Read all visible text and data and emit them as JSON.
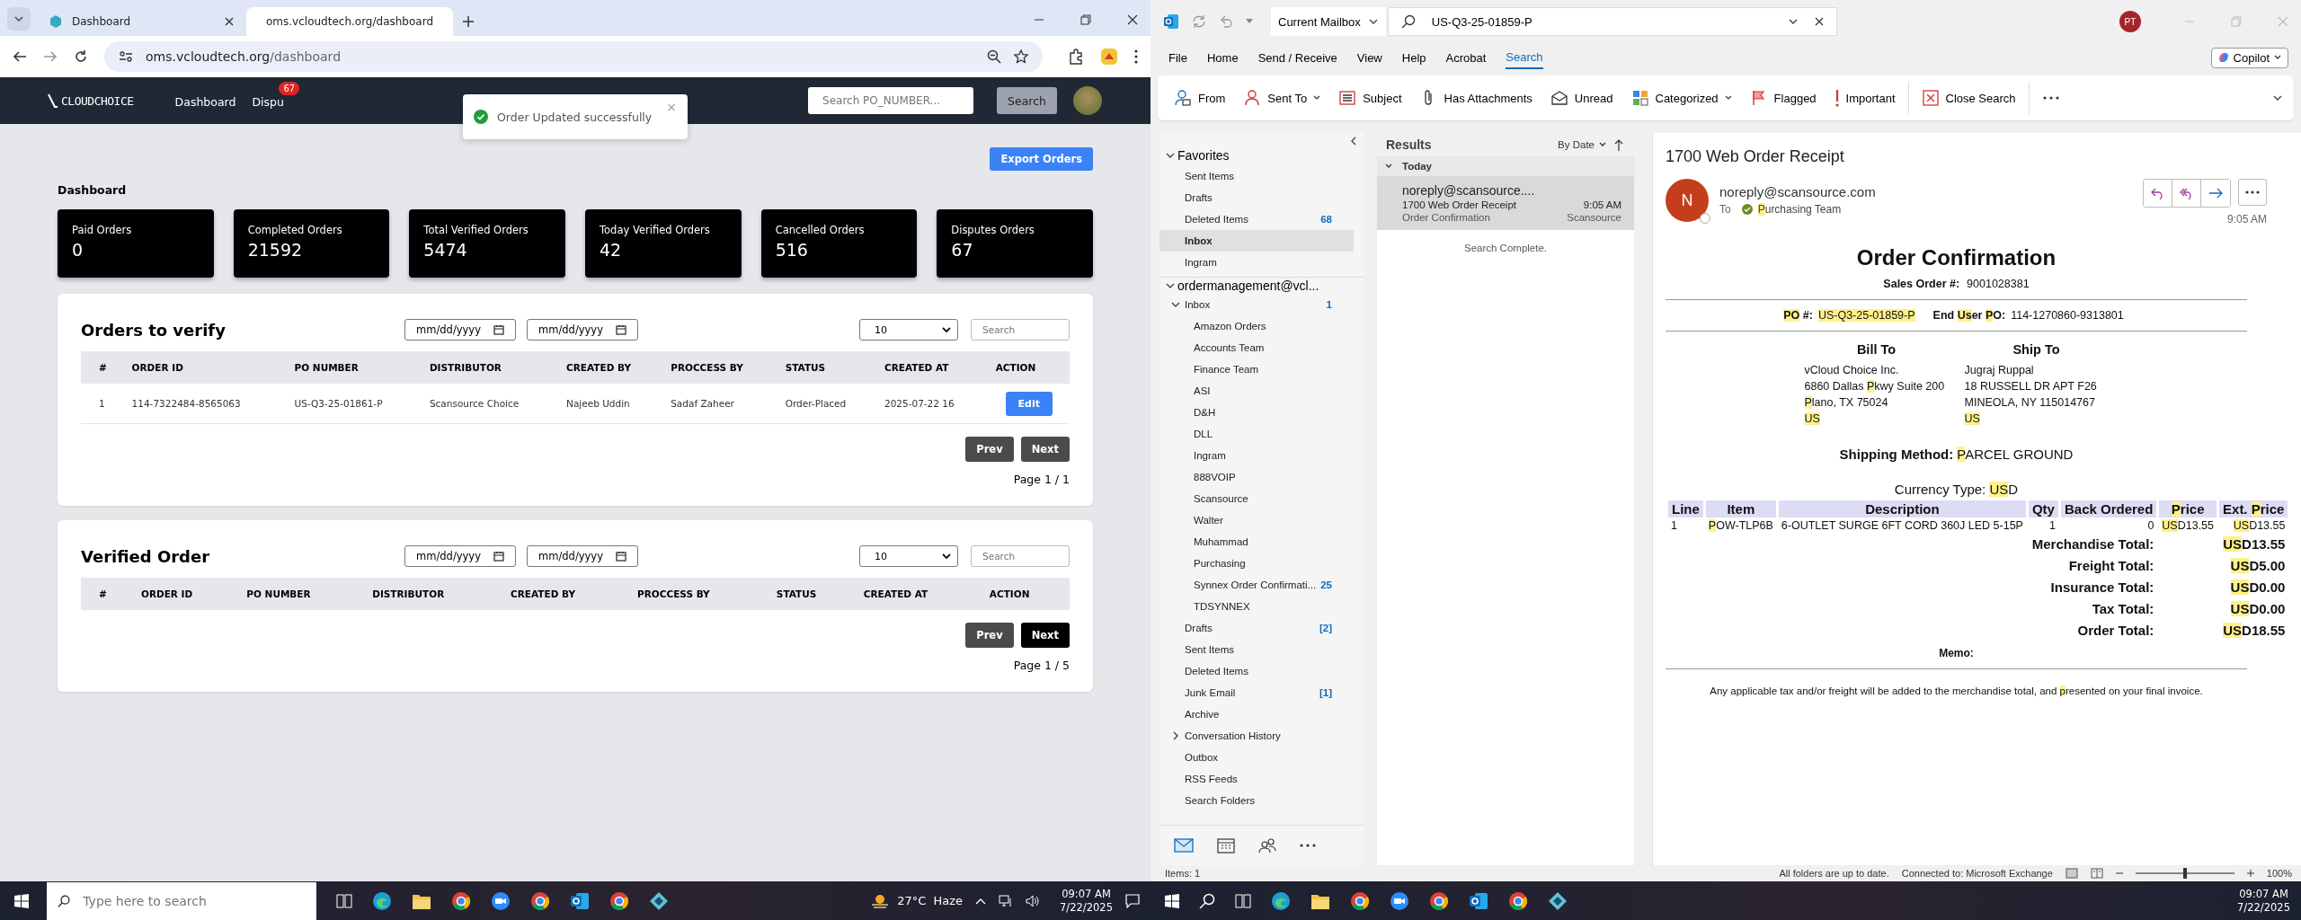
{
  "browser": {
    "tabs": [
      {
        "title": "Dashboard",
        "selected": false
      },
      {
        "title": "oms.vcloudtech.org/dashboard",
        "selected": true
      }
    ],
    "url": {
      "host": "oms.vcloudtech.org",
      "path": "/dashboard"
    }
  },
  "app": {
    "logo": "CLOUDCHOICE",
    "nav": [
      {
        "label": "Dashboard"
      },
      {
        "label": "Dispu",
        "badge": "67"
      }
    ],
    "search": {
      "placeholder": "Search PO_NUMBER..."
    },
    "search_button": "Search"
  },
  "toast": {
    "message": "Order Updated successfully",
    "close": "×"
  },
  "export_button": "Export Orders",
  "page_title": "Dashboard",
  "stats": [
    {
      "label": "Paid Orders",
      "value": "0"
    },
    {
      "label": "Completed Orders",
      "value": "21592"
    },
    {
      "label": "Total Verified Orders",
      "value": "5474"
    },
    {
      "label": "Today Verified Orders",
      "value": "42"
    },
    {
      "label": "Cancelled Orders",
      "value": "516"
    },
    {
      "label": "Disputes Orders",
      "value": "67"
    }
  ],
  "panels": [
    {
      "title": "Orders to verify",
      "date_fields": [
        {
          "placeholder": "mm/dd/yyyy"
        },
        {
          "placeholder": "mm/dd/yyyy"
        }
      ],
      "page_size": "10",
      "search": {
        "placeholder": "Search"
      },
      "columns": [
        "#",
        "ORDER ID",
        "PO NUMBER",
        "DISTRIBUTOR",
        "CREATED BY",
        "PROCCESS BY",
        "STATUS",
        "CREATED AT",
        "ACTION"
      ],
      "rows": [
        {
          "cells": [
            "1",
            "114-7322484-8565063",
            "US-Q3-25-01861-P",
            "Scansource Choice",
            "Najeeb Uddin",
            "Sadaf Zaheer",
            "Order-Placed",
            "2025-07-22 16"
          ],
          "action": "Edit"
        }
      ],
      "prev": "Prev",
      "next": "Next",
      "next_emphasized": false,
      "page": "Page 1 / 1"
    },
    {
      "title": "Verified Order",
      "date_fields": [
        {
          "placeholder": "mm/dd/yyyy"
        },
        {
          "placeholder": "mm/dd/yyyy"
        }
      ],
      "page_size": "10",
      "search": {
        "placeholder": "Search"
      },
      "columns": [
        "#",
        "ORDER ID",
        "PO NUMBER",
        "DISTRIBUTOR",
        "CREATED BY",
        "PROCCESS BY",
        "STATUS",
        "CREATED AT",
        "ACTION"
      ],
      "prev": "Prev",
      "next": "Next",
      "next_emphasized": true,
      "page": "Page 1 / 5"
    }
  ],
  "outlook": {
    "scope": "Current Mailbox",
    "search_query": "US-Q3-25-01859-P",
    "user_initials": "PT",
    "menu": [
      {
        "label": "File",
        "selected": false
      },
      {
        "label": "Home",
        "selected": false
      },
      {
        "label": "Send / Receive",
        "selected": false
      },
      {
        "label": "View",
        "selected": false
      },
      {
        "label": "Help",
        "selected": false
      },
      {
        "label": "Acrobat",
        "selected": false
      },
      {
        "label": "Search",
        "selected": true
      }
    ],
    "copilot": "Copilot",
    "ribbon": [
      {
        "kind": "from",
        "label": "From",
        "dropdown": false
      },
      {
        "kind": "sentto",
        "label": "Sent To",
        "dropdown": true
      },
      {
        "kind": "subject",
        "label": "Subject",
        "dropdown": false
      },
      {
        "kind": "attach",
        "label": "Has Attachments",
        "dropdown": false
      },
      {
        "kind": "unread",
        "label": "Unread",
        "dropdown": false
      },
      {
        "kind": "categorized",
        "label": "Categorized",
        "dropdown": true
      },
      {
        "kind": "flagged",
        "label": "Flagged",
        "dropdown": false
      },
      {
        "kind": "important",
        "label": "Important",
        "dropdown": false
      },
      {
        "kind": "close",
        "label": "Close Search",
        "dropdown": false
      }
    ],
    "favorites": {
      "title": "Favorites",
      "items": [
        {
          "name": "Sent Items",
          "selected": false
        },
        {
          "name": "Drafts",
          "selected": false
        },
        {
          "name": "Deleted Items",
          "count": "68",
          "selected": false
        },
        {
          "name": "Inbox",
          "selected": true
        },
        {
          "name": "Ingram",
          "selected": false
        }
      ]
    },
    "account": {
      "name": "ordermanagement@vcl...",
      "folders": [
        {
          "name": "Inbox",
          "count": "1",
          "expanded": true,
          "children": [
            {
              "name": "Amazon Orders"
            },
            {
              "name": "Accounts Team"
            },
            {
              "name": "Finance Team"
            },
            {
              "name": "ASI"
            },
            {
              "name": "D&H"
            },
            {
              "name": "DLL"
            },
            {
              "name": "Ingram"
            },
            {
              "name": "888VOIP"
            },
            {
              "name": "Scansource"
            },
            {
              "name": "Walter"
            },
            {
              "name": "Muhammad"
            },
            {
              "name": "Purchasing"
            },
            {
              "name": "Synnex Order Confirmati...",
              "count": "25"
            },
            {
              "name": "TDSYNNEX"
            }
          ]
        },
        {
          "name": "Drafts",
          "count": "[2]"
        },
        {
          "name": "Sent Items"
        },
        {
          "name": "Deleted Items"
        },
        {
          "name": "Junk Email",
          "count": "[1]"
        },
        {
          "name": "Archive"
        },
        {
          "name": "Conversation History",
          "expanded": false
        },
        {
          "name": "Outbox"
        },
        {
          "name": "RSS Feeds"
        },
        {
          "name": "Search Folders"
        }
      ]
    },
    "results": {
      "title": "Results",
      "sort": "By Date",
      "group": "Today",
      "items": [
        {
          "sender": "noreply@scansource....",
          "subject": "1700 Web Order Receipt",
          "preview": "Order Confirmation",
          "time": "9:05 AM",
          "folder": "Scansource",
          "selected": true
        }
      ],
      "status": "Search Complete."
    },
    "message": {
      "subject": "1700 Web Order Receipt",
      "avatar": "N",
      "from": "noreply@scansource.com",
      "to_label": "To",
      "to": [
        {
          "text": "P",
          "highlight": true
        },
        {
          "text": "urchasing Team",
          "highlight": false
        }
      ],
      "time": "9:05 AM",
      "title": "Order Confirmation",
      "sales_order": {
        "label": "Sales Order #:",
        "value": "9001028381"
      },
      "po": {
        "label": [
          {
            "text": "PO",
            "highlight": true
          },
          {
            "text": " #:",
            "highlight": false
          }
        ],
        "value": [
          {
            "text": "US-Q3-25-01859-P",
            "highlight": true
          }
        ]
      },
      "end_user_po": {
        "label": [
          {
            "text": "End ",
            "highlight": false
          },
          {
            "text": "Us",
            "highlight": true
          },
          {
            "text": "er ",
            "highlight": false
          },
          {
            "text": "P",
            "highlight": true
          },
          {
            "text": "O:",
            "highlight": false
          }
        ],
        "value": "114-1270860-9313801"
      },
      "bill_to": {
        "title": "Bill To",
        "lines": [
          "vCloud Choice Inc.",
          [
            {
              "text": "6860 Dallas ",
              "highlight": false
            },
            {
              "text": "P",
              "highlight": true
            },
            {
              "text": "kwy Suite 200",
              "highlight": false
            }
          ],
          [
            {
              "text": "P",
              "highlight": true
            },
            {
              "text": "lano, TX 75024",
              "highlight": false
            }
          ],
          [
            {
              "text": "US",
              "highlight": true
            }
          ]
        ]
      },
      "ship_to": {
        "title": "Ship To",
        "lines": [
          "Jugraj Ruppal",
          "18 RUSSELL DR APT F26",
          "MINEOLA, NY 115014767",
          [
            {
              "text": "US",
              "highlight": true
            }
          ]
        ]
      },
      "shipping": {
        "label": "Shipping Method:",
        "value": [
          {
            "text": "P",
            "highlight": true
          },
          {
            "text": "ARCEL GROUND",
            "highlight": false
          }
        ]
      },
      "currency": [
        {
          "text": "Currency Type: ",
          "highlight": false
        },
        {
          "text": "US",
          "highlight": true
        },
        {
          "text": "D",
          "highlight": false
        }
      ],
      "columns": [
        "Line",
        "Item",
        "Description",
        "Qty",
        "Back Ordered",
        [
          {
            "text": "P",
            "highlight": true
          },
          {
            "text": "rice",
            "highlight": false
          }
        ],
        [
          {
            "text": "Ext. ",
            "highlight": false
          },
          {
            "text": "P",
            "highlight": true
          },
          {
            "text": "rice",
            "highlight": false
          }
        ]
      ],
      "lines": [
        [
          "1",
          [
            {
              "text": "P",
              "highlight": true
            },
            {
              "text": "OW-TLP6B",
              "highlight": false
            }
          ],
          "6-OUTLET SURGE 6FT CORD 360J LED 5-15P",
          "1",
          "0",
          [
            {
              "text": "US",
              "highlight": true
            },
            {
              "text": "D13.55",
              "highlight": false
            }
          ],
          [
            {
              "text": "US",
              "highlight": true
            },
            {
              "text": "D13.55",
              "highlight": false
            }
          ]
        ]
      ],
      "totals": [
        {
          "label": "Merchandise Total:",
          "value": [
            {
              "text": "US",
              "highlight": true
            },
            {
              "text": "D13.55",
              "highlight": false
            }
          ]
        },
        {
          "label": "Freight Total:",
          "value": [
            {
              "text": "US",
              "highlight": true
            },
            {
              "text": "D5.00",
              "highlight": false
            }
          ]
        },
        {
          "label": "Insurance Total:",
          "value": [
            {
              "text": "US",
              "highlight": true
            },
            {
              "text": "D0.00",
              "highlight": false
            }
          ]
        },
        {
          "label": "Tax Total:",
          "value": [
            {
              "text": "US",
              "highlight": true
            },
            {
              "text": "D0.00",
              "highlight": false
            }
          ]
        },
        {
          "label": "Order Total:",
          "value": [
            {
              "text": "US",
              "highlight": true
            },
            {
              "text": "D18.55",
              "highlight": false
            }
          ]
        }
      ],
      "memo": "Memo:",
      "footer": [
        {
          "text": "Any applicable tax and/or freight will be added to the merchandise total, and ",
          "highlight": false
        },
        {
          "text": "p",
          "highlight": true
        },
        {
          "text": "resented on your final invoice.",
          "highlight": false
        }
      ]
    },
    "status_bar": {
      "items": "Items: 1",
      "sync": "All folders are up to date.",
      "connection": "Connected to: Microsoft Exchange",
      "zoom": {
        "level": 0.5
      },
      "zoom_value": "100%"
    }
  },
  "taskbar_left": {
    "search_placeholder": "Type here to search",
    "weather": {
      "temp": "27°C",
      "condition": "Haze"
    },
    "time": "09:07 AM",
    "date": "7/22/2025"
  },
  "taskbar_right": {
    "time": "09:07 AM",
    "date": "7/22/2025"
  }
}
